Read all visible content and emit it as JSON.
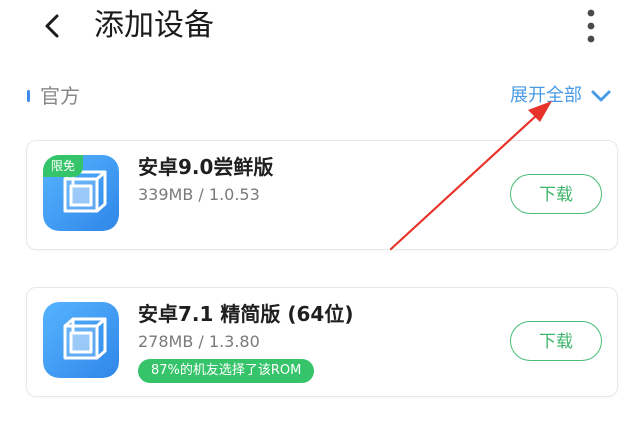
{
  "header": {
    "title": "添加设备",
    "back_icon": "back-chevron-icon",
    "more_icon": "more-vertical-icon"
  },
  "section": {
    "label": "官方",
    "expand_label": "展开全部",
    "expand_icon": "chevron-down-icon"
  },
  "apps": [
    {
      "name": "安卓9.0尝鲜版",
      "meta": "339MB / 1.0.53",
      "badge": "限免",
      "icon": "virtual-cube-app-icon",
      "download_label": "下载"
    },
    {
      "name": "安卓7.1 精简版 (64位)",
      "meta": "278MB / 1.3.80",
      "tag": "87%的机友选择了该ROM",
      "icon": "virtual-cube-app-icon",
      "download_label": "下载"
    }
  ],
  "colors": {
    "accent_blue": "#4a9be6",
    "accent_green": "#36c46b",
    "annotation_red": "#e8332a"
  }
}
